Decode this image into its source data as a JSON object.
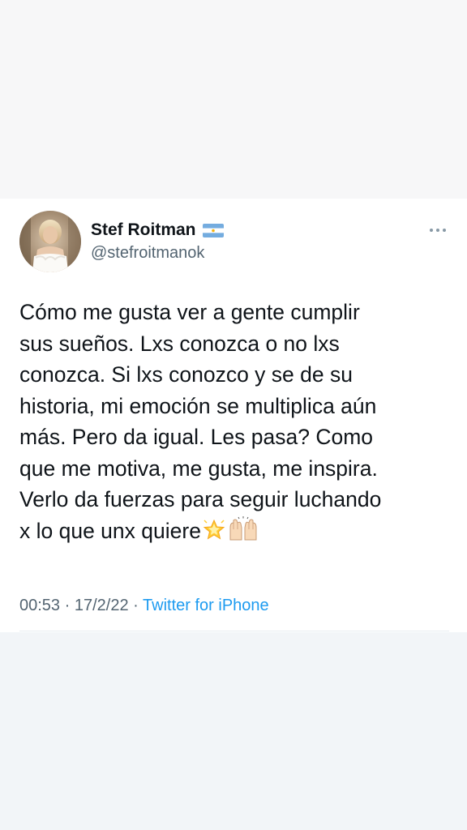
{
  "tweet": {
    "author_name": "Stef Roitman",
    "author_flag": "argentina-flag",
    "handle": "@stefroitmanok",
    "more_icon": "more-dots-icon",
    "text_lines": [
      "Cómo me gusta ver a gente cumplir",
      "sus sueños. Lxs conozca o no lxs",
      "conozca. Si lxs conozco y se de su",
      "historia, mi emoción se multiplica aún",
      "más. Pero da igual. Les pasa? Como",
      "que me motiva, me gusta, me inspira.",
      "Verlo da fuerzas para seguir luchando",
      "x lo que unx quiere"
    ],
    "emojis": [
      "glowing-star-icon",
      "raising-hands-icon"
    ],
    "time": "00:53",
    "separator": "·",
    "date": "17/2/22",
    "source": "Twitter for iPhone"
  },
  "colors": {
    "text_primary": "#0f1419",
    "text_secondary": "#536471",
    "link": "#1d9bf0",
    "divider": "#e6ecf0"
  }
}
